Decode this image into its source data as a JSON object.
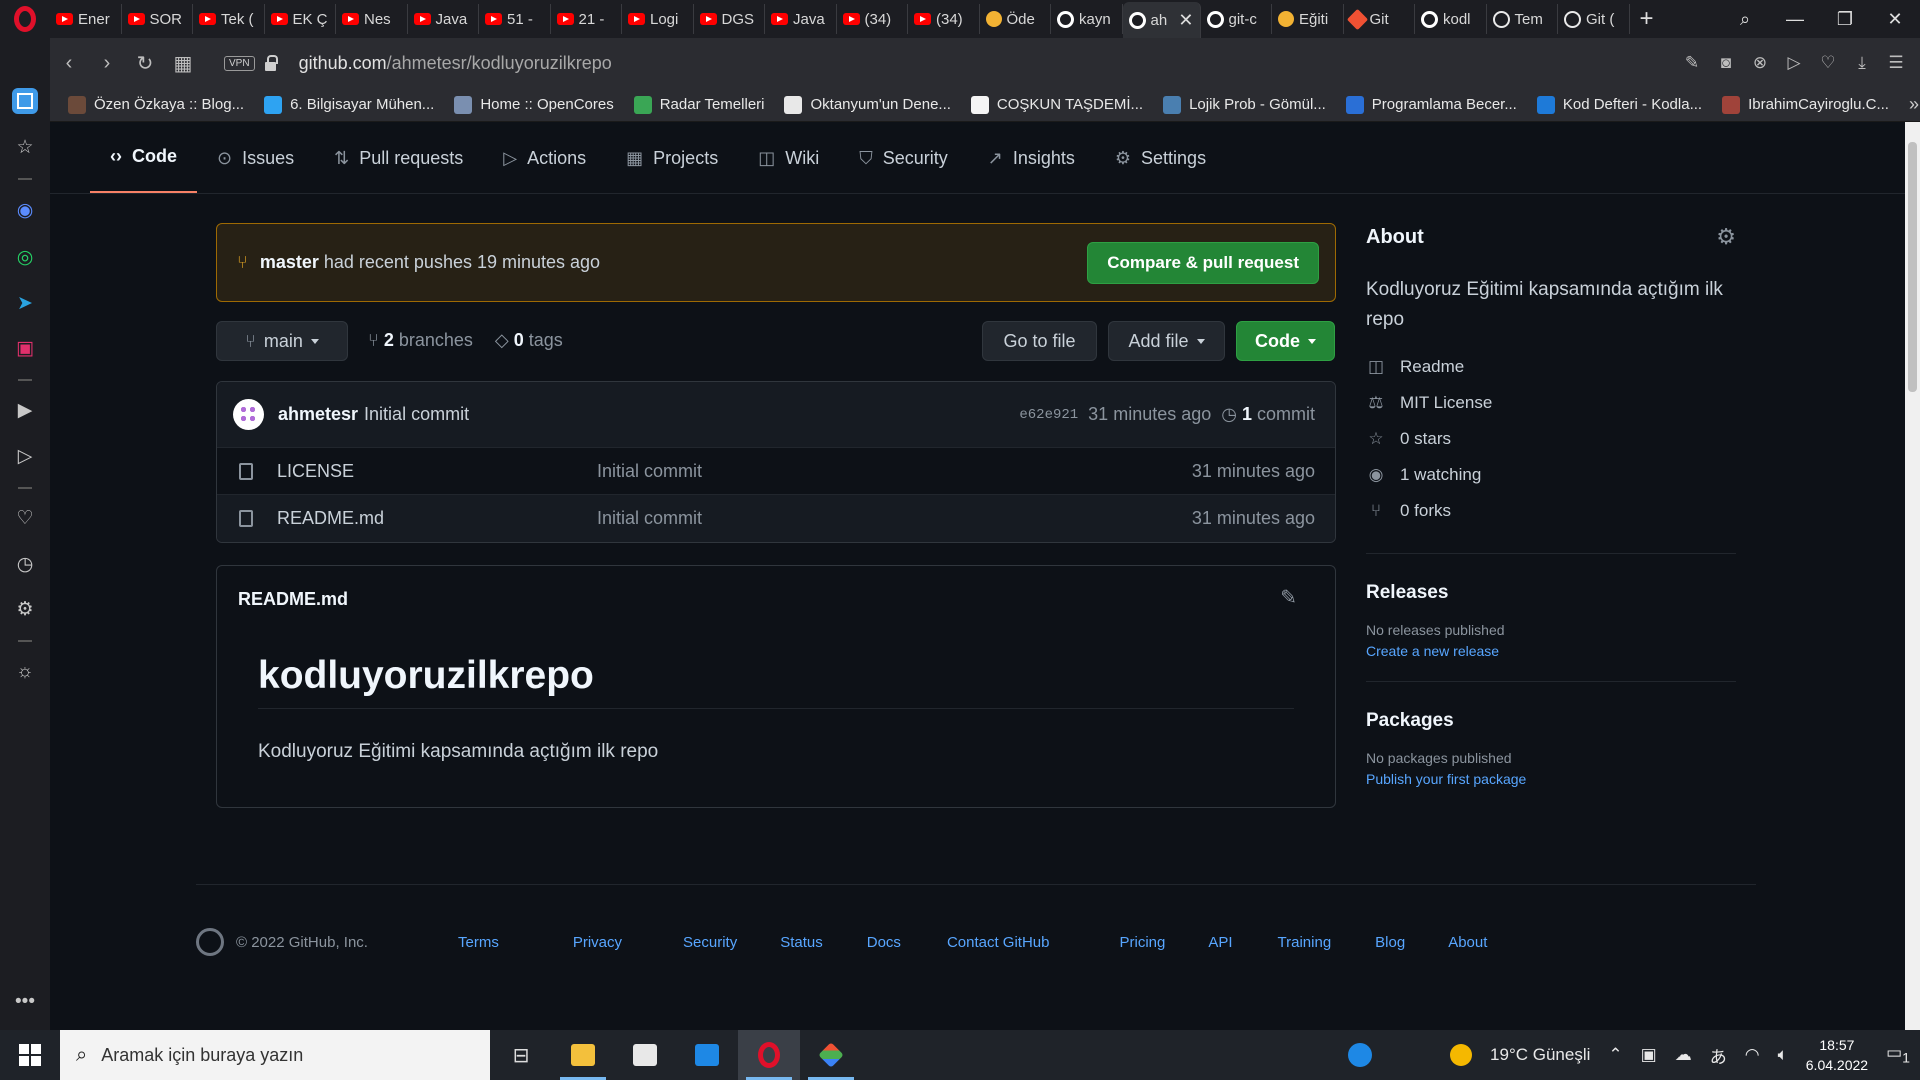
{
  "browser": {
    "tabs": [
      {
        "label": "Ener",
        "icon": "youtube-icon"
      },
      {
        "label": "SOR",
        "icon": "youtube-icon"
      },
      {
        "label": "Tek (",
        "icon": "youtube-icon"
      },
      {
        "label": "EK Ç",
        "icon": "youtube-icon"
      },
      {
        "label": "Nes",
        "icon": "youtube-icon"
      },
      {
        "label": "Java",
        "icon": "youtube-icon"
      },
      {
        "label": "51 -",
        "icon": "youtube-icon"
      },
      {
        "label": "21 -",
        "icon": "youtube-icon"
      },
      {
        "label": "Logi",
        "icon": "youtube-icon"
      },
      {
        "label": "DGS",
        "icon": "youtube-icon"
      },
      {
        "label": "Java",
        "icon": "youtube-icon"
      },
      {
        "label": "(34)",
        "icon": "youtube-icon"
      },
      {
        "label": "(34)",
        "icon": "youtube-icon"
      },
      {
        "label": "Öde",
        "icon": "circle-icon"
      },
      {
        "label": "kayn",
        "icon": "github-icon"
      },
      {
        "label": "ah",
        "icon": "github-icon",
        "active": true
      },
      {
        "label": "git-c",
        "icon": "github-icon"
      },
      {
        "label": "Eğiti",
        "icon": "circle-icon"
      },
      {
        "label": "Git",
        "icon": "git-icon"
      },
      {
        "label": "kodl",
        "icon": "github-icon"
      },
      {
        "label": "Tem",
        "icon": "globe-icon"
      },
      {
        "label": "Git (",
        "icon": "globe-icon"
      }
    ],
    "url_host": "github.com",
    "url_path": "/ahmetesr/kodluyoruzilkrepo",
    "vpn_label": "VPN",
    "bookmarks": [
      {
        "label": "Özen Özkaya :: Blog...",
        "color": "#6b4a3a"
      },
      {
        "label": "6. Bilgisayar Mühen...",
        "color": "#2ea3f2"
      },
      {
        "label": "Home :: OpenCores",
        "color": "#7a8fb0"
      },
      {
        "label": "Radar Temelleri",
        "color": "#3aa655"
      },
      {
        "label": "Oktanyum'un Dene...",
        "color": "#e8e8e8"
      },
      {
        "label": "COŞKUN TAŞDEMİ...",
        "color": "#f5f5f5"
      },
      {
        "label": "Lojik Prob - Gömül...",
        "color": "#4a7fb0"
      },
      {
        "label": "Programlama Becer...",
        "color": "#2a6fd6"
      },
      {
        "label": "Kod Defteri - Kodla...",
        "color": "#1e7ad8"
      },
      {
        "label": "IbrahimCayiroglu.C...",
        "color": "#a0433a"
      }
    ]
  },
  "repo_nav": {
    "tabs": [
      {
        "label": "Code",
        "icon": "code-icon",
        "active": true
      },
      {
        "label": "Issues",
        "icon": "issue-icon"
      },
      {
        "label": "Pull requests",
        "icon": "pull-request-icon"
      },
      {
        "label": "Actions",
        "icon": "play-icon"
      },
      {
        "label": "Projects",
        "icon": "table-icon"
      },
      {
        "label": "Wiki",
        "icon": "book-icon"
      },
      {
        "label": "Security",
        "icon": "shield-icon"
      },
      {
        "label": "Insights",
        "icon": "graph-icon"
      },
      {
        "label": "Settings",
        "icon": "gear-icon"
      }
    ]
  },
  "push_banner": {
    "branch": "master",
    "text": " had recent pushes 19 minutes ago",
    "button": "Compare & pull request"
  },
  "toolbar": {
    "branch": "main",
    "branches_count": "2",
    "branches_label": " branches",
    "tags_count": "0",
    "tags_label": " tags",
    "go_to_file": "Go to file",
    "add_file": "Add file",
    "code": "Code"
  },
  "commit": {
    "author": "ahmetesr",
    "message": "Initial commit",
    "hash": "e62e921",
    "time": "31 minutes ago",
    "count": "1",
    "count_label": " commit"
  },
  "files": [
    {
      "name": "LICENSE",
      "message": "Initial commit",
      "time": "31 minutes ago"
    },
    {
      "name": "README.md",
      "message": "Initial commit",
      "time": "31 minutes ago"
    }
  ],
  "readme": {
    "file": "README.md",
    "heading": "kodluyoruzilkrepo",
    "body": "Kodluyoruz Eğitimi kapsamında açtığım ilk repo"
  },
  "about": {
    "title": "About",
    "description": "Kodluyoruz Eğitimi kapsamında açtığım ilk repo",
    "items": [
      {
        "label": "Readme",
        "icon": "book-icon"
      },
      {
        "label": "MIT License",
        "icon": "law-icon"
      },
      {
        "label": "0 stars",
        "icon": "star-icon"
      },
      {
        "label": "1 watching",
        "icon": "eye-icon"
      },
      {
        "label": "0 forks",
        "icon": "fork-icon"
      }
    ]
  },
  "releases": {
    "title": "Releases",
    "empty": "No releases published",
    "link": "Create a new release"
  },
  "packages": {
    "title": "Packages",
    "empty": "No packages published",
    "link": "Publish your first package"
  },
  "footer": {
    "copyright": "© 2022 GitHub, Inc.",
    "links": [
      "Terms",
      "Privacy",
      "Security",
      "Status",
      "Docs",
      "Contact GitHub",
      "Pricing",
      "API",
      "Training",
      "Blog",
      "About"
    ]
  },
  "taskbar": {
    "search_placeholder": "Aramak için buraya yazın",
    "weather": "19°C  Güneşli",
    "time": "18:57",
    "date": "6.04.2022",
    "notifications": "1"
  }
}
